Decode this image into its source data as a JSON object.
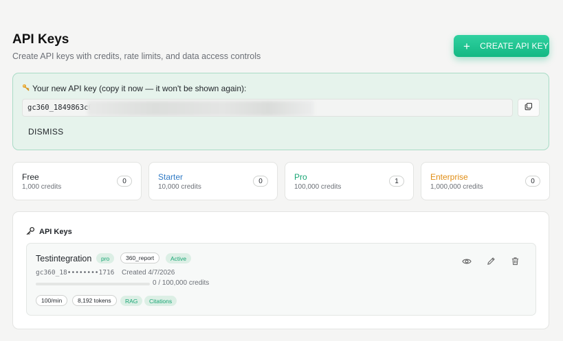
{
  "header": {
    "title": "API Keys",
    "subtitle": "Create API keys with credits, rate limits, and data access controls",
    "create_button": "CREATE API KEY"
  },
  "new_key": {
    "label": "Your new API key (copy it now — it won't be shown again):",
    "value": "gc360_1849863c0",
    "dismiss": "DISMISS"
  },
  "tiers": [
    {
      "name": "Free",
      "credits": "1,000 credits",
      "count": "0",
      "color": "#1f2328"
    },
    {
      "name": "Starter",
      "credits": "10,000 credits",
      "count": "0",
      "color": "#2f7ac5"
    },
    {
      "name": "Pro",
      "credits": "100,000 credits",
      "count": "1",
      "color": "#18a574"
    },
    {
      "name": "Enterprise",
      "credits": "1,000,000 credits",
      "count": "0",
      "color": "#e08c12"
    }
  ],
  "keys_section": {
    "title": "API Keys",
    "items": [
      {
        "name": "Testintegration",
        "tier_badge": "pro",
        "scope_badge": "360_report",
        "status_badge": "Active",
        "masked_key": "gc360_18••••••••1716",
        "created": "Created 4/7/2026",
        "usage": "0 / 100,000 credits",
        "usage_fraction": 0,
        "rate_limit": "100/min",
        "tokens": "8,192 tokens",
        "features": [
          "RAG",
          "Citations"
        ]
      }
    ]
  },
  "icons": {
    "create": "plus-icon",
    "new_key": "key-icon",
    "copy": "copy-icon",
    "section": "key-outline-icon",
    "view": "eye-icon",
    "edit": "pencil-icon",
    "delete": "trash-icon"
  },
  "colors": {
    "accent": "#14b883",
    "success_bg": "#e6f3ec",
    "badge_green": "#18a574"
  }
}
